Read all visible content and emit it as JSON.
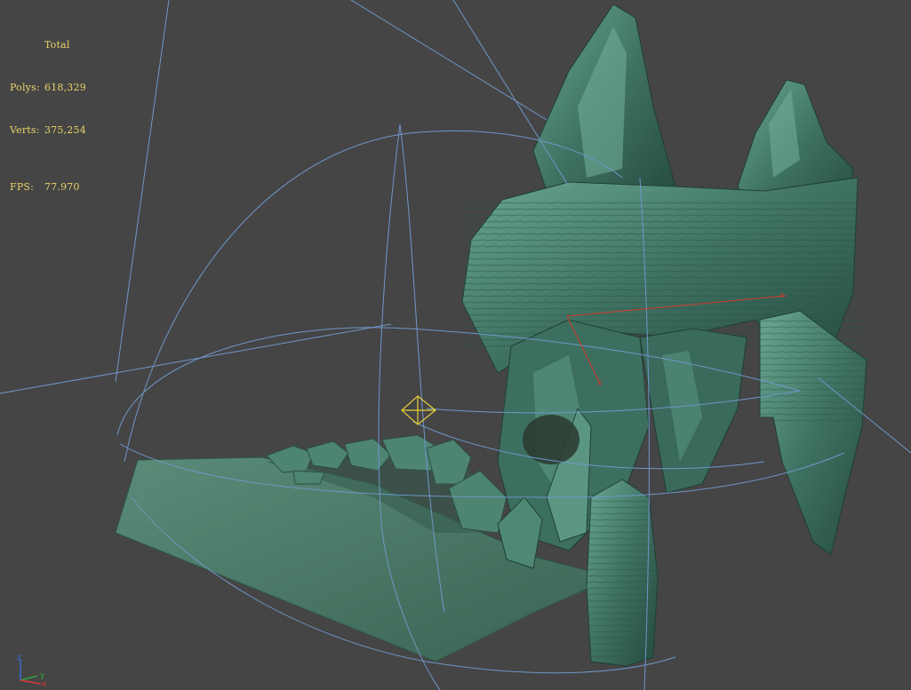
{
  "viewport": {
    "background": "#454545",
    "stats": {
      "header": "Total",
      "polys_label": "Polys:",
      "polys_value": "618,329",
      "verts_label": "Verts:",
      "verts_value": "375,254",
      "fps_label": "FPS:",
      "fps_value": "77.970",
      "color": "#e8d36a"
    },
    "axis_gizmo": {
      "z_label": "z",
      "y_label": "y",
      "x_label": "x",
      "z_color": "#3a6bd8",
      "y_color": "#2fae3a",
      "x_color": "#d83a3a"
    },
    "colors": {
      "rock_light": "#5f9a86",
      "rock_mid": "#3f7262",
      "rock_dark": "#24483d",
      "ground": "#4f7d6c",
      "ground_dark": "#3d6556",
      "wire_blue": "#6f97c8",
      "wire_red": "#d23a2a",
      "helper_yellow": "#e6cf3a"
    }
  }
}
